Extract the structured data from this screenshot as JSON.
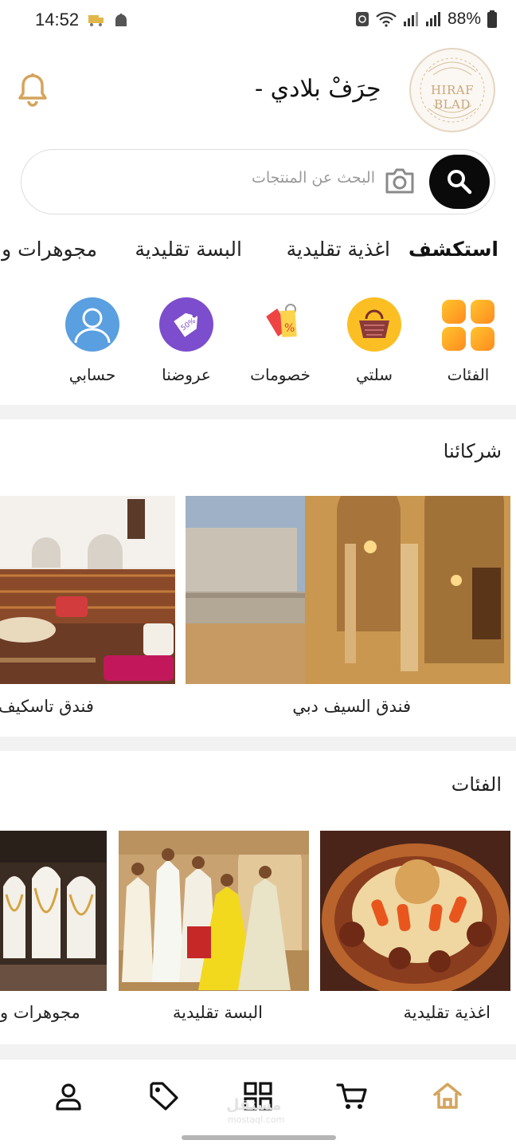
{
  "status_bar": {
    "time": "14:52",
    "battery": "88%"
  },
  "header": {
    "title": "حِرَفْ بلادي  -",
    "logo_text": "HIRAF BLAD"
  },
  "search": {
    "placeholder": "البحث عن المنتجات"
  },
  "tabs": [
    {
      "label": "استكشف",
      "active": true
    },
    {
      "label": "اغذية تقليدية",
      "active": false
    },
    {
      "label": "البسة تقليدية",
      "active": false
    },
    {
      "label": "مجوهرات و",
      "active": false
    }
  ],
  "quick_links": [
    {
      "label": "الفئات",
      "icon": "grid-icon"
    },
    {
      "label": "سلتي",
      "icon": "basket-icon"
    },
    {
      "label": "خصومات",
      "icon": "discount-tag-icon"
    },
    {
      "label": "عروضنا",
      "icon": "offer-tag-icon"
    },
    {
      "label": "حسابي",
      "icon": "user-avatar-icon"
    }
  ],
  "partners": {
    "title": "شركائنا",
    "items": [
      {
        "label": "فندق السيف دبي"
      },
      {
        "label": "فندق تاسكيف"
      }
    ]
  },
  "categories": {
    "title": "الفئات",
    "items": [
      {
        "label": "اغذية تقليدية"
      },
      {
        "label": "البسة تقليدية"
      },
      {
        "label": "مجوهرات و"
      }
    ]
  },
  "bottom_nav": [
    "home-icon",
    "cart-icon",
    "grid-icon",
    "tag-icon",
    "user-icon"
  ],
  "watermark": {
    "text": "مستقل",
    "sub": "mostaql.com"
  },
  "colors": {
    "accent": "#d4a45c",
    "search_button": "#0a0a0a",
    "divider": "#f2f2f2"
  }
}
